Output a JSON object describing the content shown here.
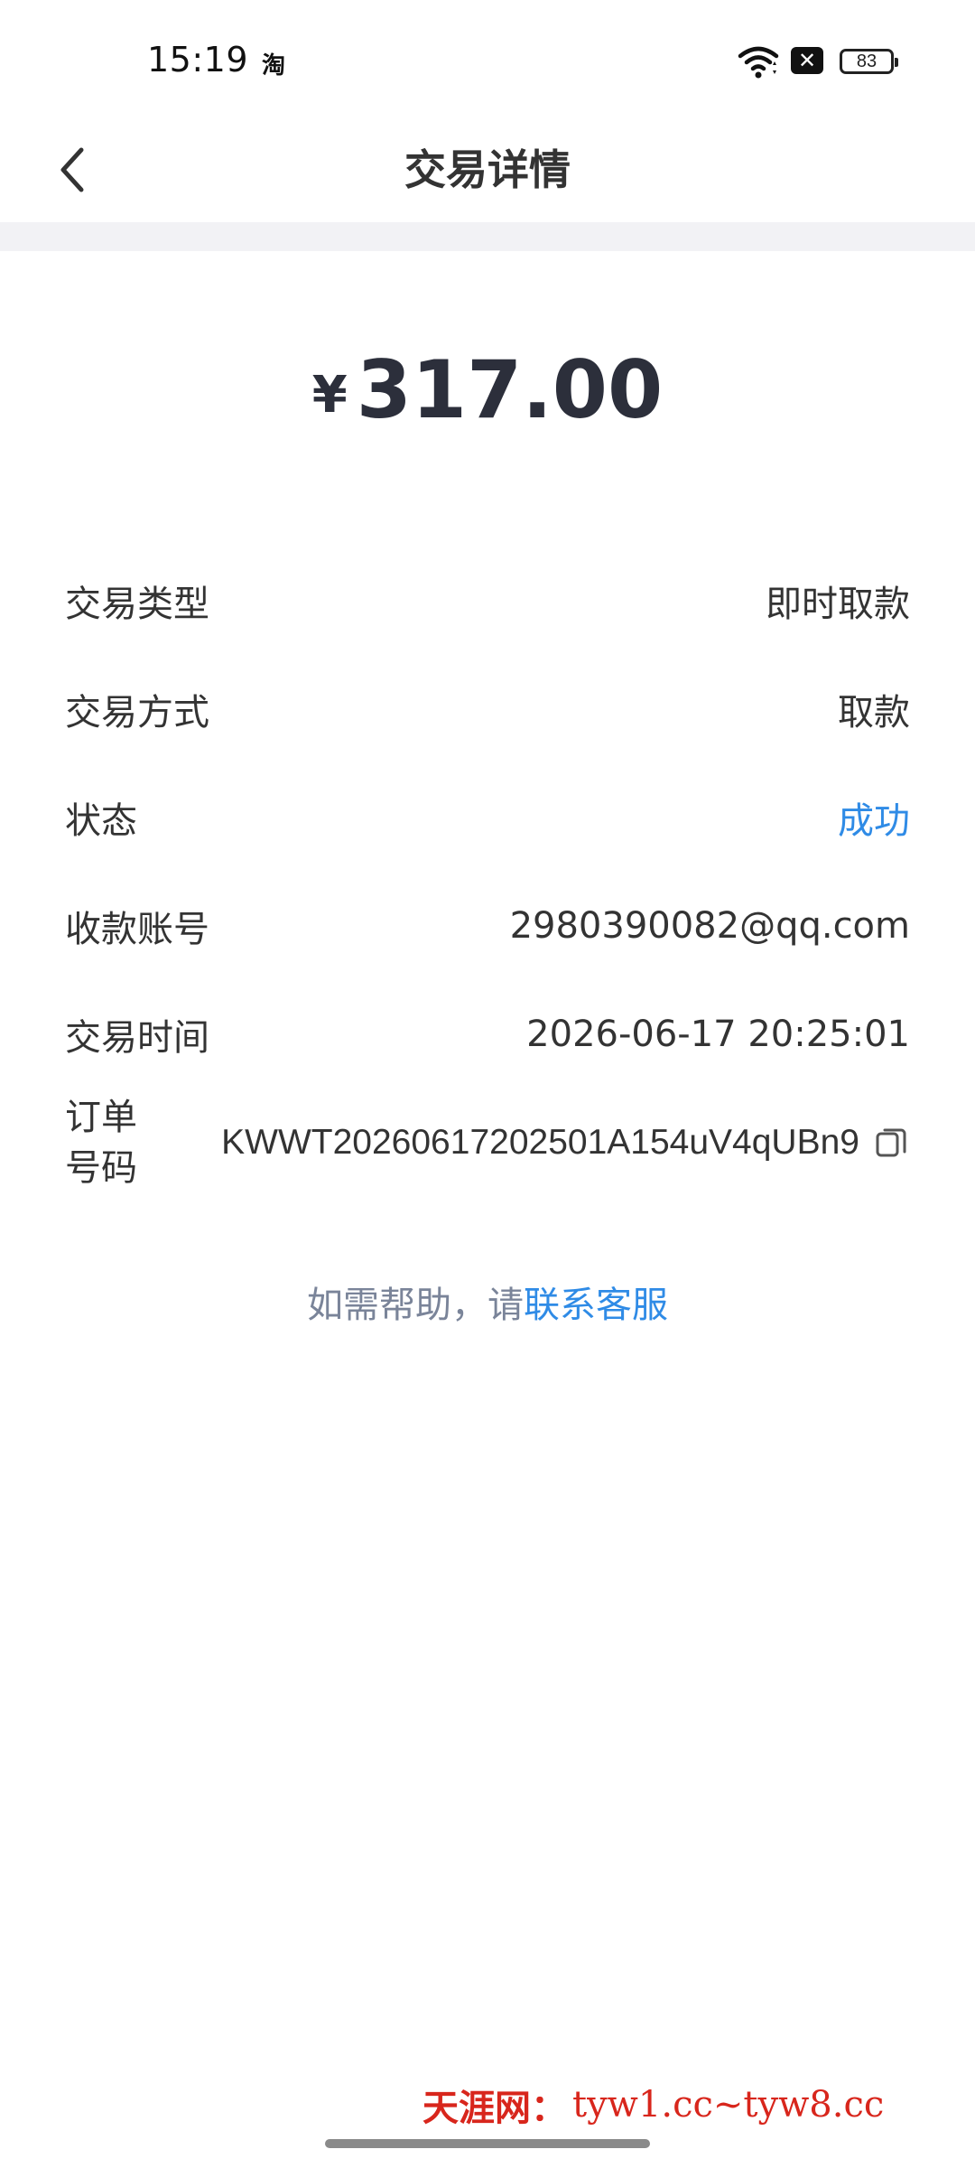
{
  "status_bar": {
    "time": "15:19",
    "app_indicator": "淘",
    "battery": "83",
    "close_badge": "✕",
    "icons": [
      "wifi-icon",
      "close-badge-icon",
      "battery-icon"
    ]
  },
  "nav": {
    "title": "交易详情",
    "back_icon": "chevron-left-icon"
  },
  "amount": {
    "currency": "¥",
    "value": "317.00"
  },
  "details": {
    "rows": [
      {
        "label": "交易类型",
        "value": "即时取款"
      },
      {
        "label": "交易方式",
        "value": "取款"
      },
      {
        "label": "状态",
        "value": "成功"
      },
      {
        "label": "收款账号",
        "value": "2980390082@qq.com"
      },
      {
        "label": "交易时间",
        "value": "2026-06-17 20:25:01"
      }
    ],
    "order": {
      "label": "订单号码",
      "value": "KWWT20260617202501A154uV4qUBn9",
      "copy_icon": "copy-icon"
    }
  },
  "help": {
    "prefix": "如需帮助，请",
    "link": "联系客服"
  },
  "watermark": {
    "brand": "天涯网：",
    "url": "tyw1.cc~tyw8.cc"
  },
  "colors": {
    "success": "#2f8be6",
    "link": "#2f8be6",
    "amount": "#2c2f3b",
    "divider": "#f2f2f5",
    "watermark": "#d8261c"
  }
}
